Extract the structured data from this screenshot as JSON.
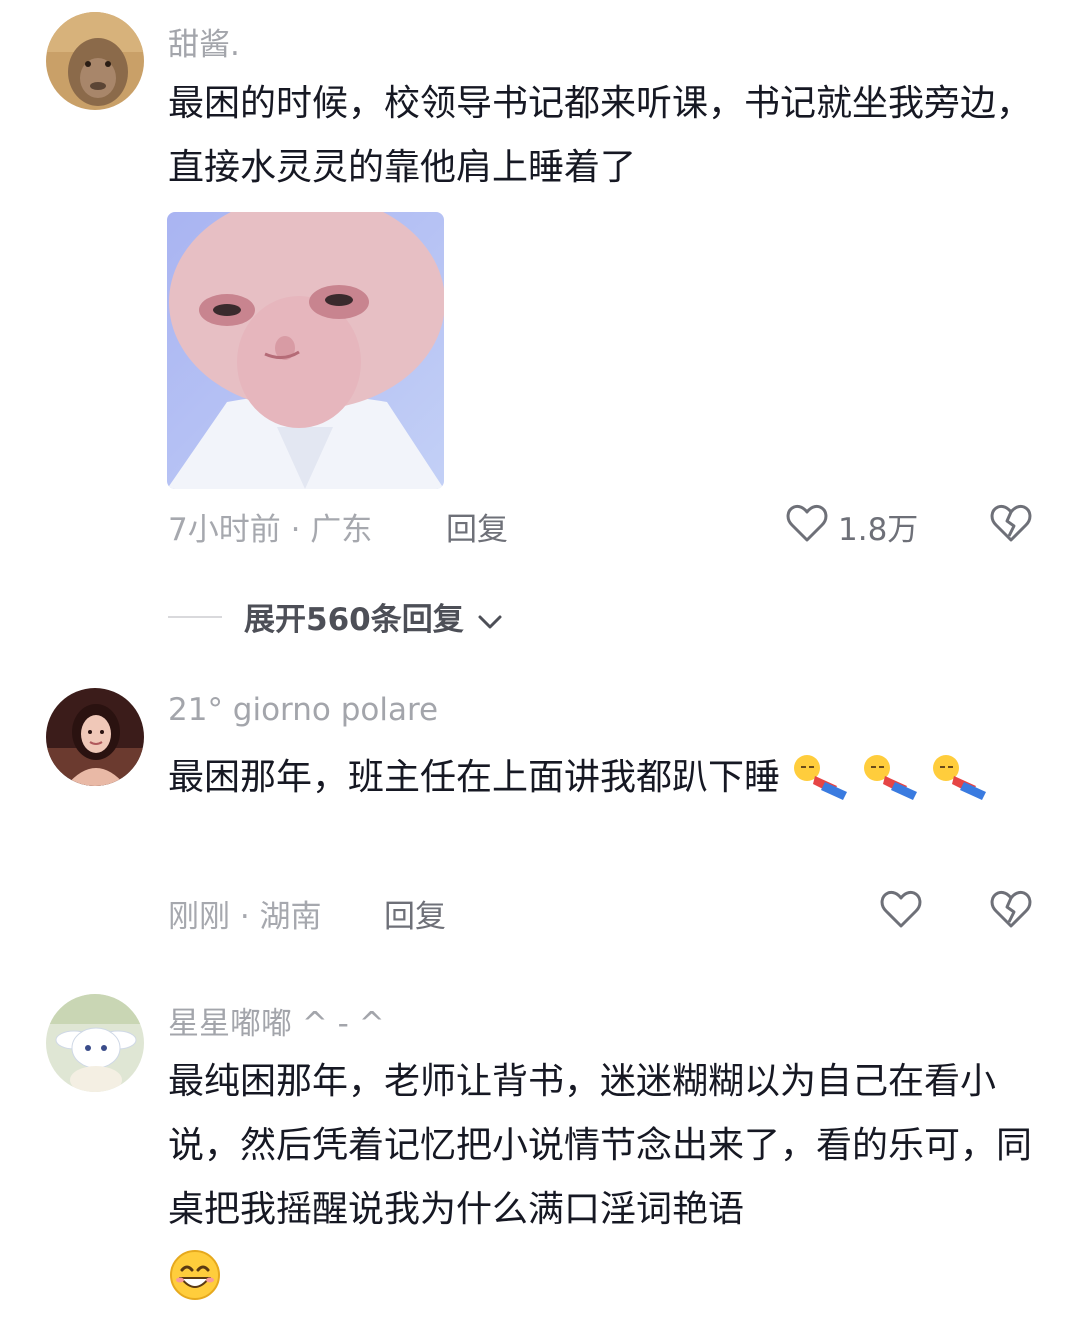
{
  "comments": [
    {
      "username": "甜酱.",
      "text": "最困的时候，校领导书记都来听课，书记就坐我旁边，直接水灵灵的靠他肩上睡着了",
      "meta": "7小时前 · 广东",
      "reply": "回复",
      "likes": "1.8万",
      "avatar_icon": "monkey-avatar",
      "image_icon": "face-meme-image"
    },
    {
      "username": "21° giorno polare",
      "text": "最困那年，班主任在上面讲我都趴下睡",
      "meta": "刚刚 · 湖南",
      "reply": "回复",
      "avatar_icon": "woman-avatar",
      "emoji_icon": "sleeping-person-emoji"
    },
    {
      "username": "星星嘟嘟 ^ - ^",
      "text": "最纯困那年，老师让背书，迷迷糊糊以为自己在看小说，然后凭着记忆把小说情节念出来了，看的乐可，同桌把我摇醒说我为什么满口淫词艳语",
      "avatar_icon": "cinnamoroll-avatar",
      "emoji_icon": "grinning-emoji"
    }
  ],
  "expand_replies": "展开560条回复",
  "colors": {
    "text": "#161823",
    "muted": "#a6a8ae",
    "secondary": "#6e7078"
  }
}
